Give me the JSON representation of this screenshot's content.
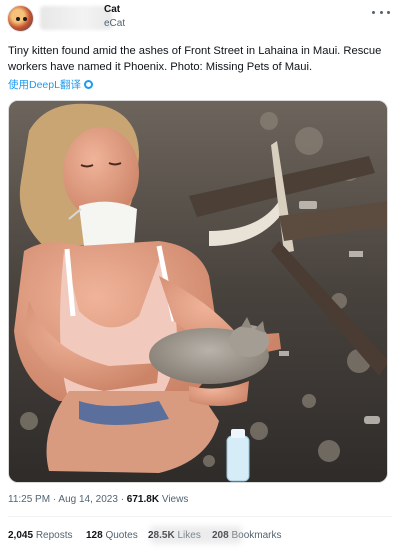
{
  "author": {
    "display_name": "Cat",
    "handle": "eCat"
  },
  "tweet": {
    "text": "Tiny kitten found amid the ashes of Front Street in Lahaina in Maui. Rescue workers have named it Phoenix. Photo: Missing Pets of Maui.",
    "translate_label": "使用DeepL翻译"
  },
  "media": {
    "description_icon": "photo"
  },
  "meta": {
    "time": "11:25 PM",
    "date": "Aug 14, 2023",
    "views_count": "671.8K",
    "views_label": "Views"
  },
  "stats": {
    "reposts_count": "2,045",
    "reposts_label": "Reposts",
    "quotes_count": "128",
    "quotes_label": "Quotes",
    "likes_count": "28.5K",
    "likes_label": "Likes",
    "bookmarks_count": "208",
    "bookmarks_label": "Bookmarks"
  },
  "colors": {
    "link": "#1d9bf0",
    "muted": "#536471",
    "text": "#0f1419"
  }
}
